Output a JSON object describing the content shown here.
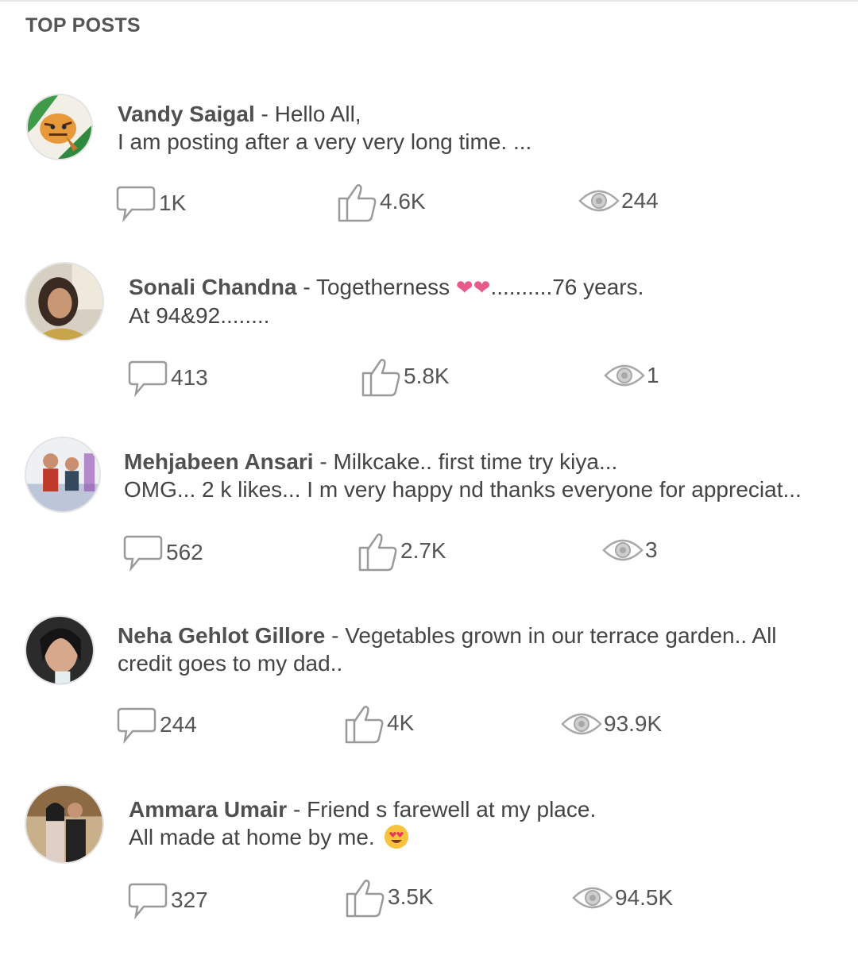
{
  "header": {
    "title": "TOP POSTS"
  },
  "separator": " - ",
  "posts": [
    {
      "author": "Vandy Saigal",
      "line1": "Hello All,",
      "line2": "I am posting after a very very long time. ...",
      "comments": "1K",
      "likes": "4.6K",
      "views": "244",
      "avatar": "tiger-painting"
    },
    {
      "author": "Sonali Chandna",
      "line1": "Togetherness ",
      "line1_emoji": "❤❤",
      "line1_after": "..........76 years.",
      "line2": "At 94&92........",
      "comments": "413",
      "likes": "5.8K",
      "views": "1",
      "avatar": "woman-portrait"
    },
    {
      "author": "Mehjabeen Ansari",
      "line1": "Milkcake.. first time try kiya...",
      "line2": "OMG... 2 k likes... I m very happy nd thanks everyone for appreciat...",
      "comments": "562",
      "likes": "2.7K",
      "views": "3",
      "avatar": "children-photo"
    },
    {
      "author": "Neha Gehlot Gillore",
      "line1": "Vegetables grown in our terrace garden.. All",
      "line2": "credit goes to my dad..",
      "comments": "244",
      "likes": "4K",
      "views": "93.9K",
      "avatar": "woman-selfie"
    },
    {
      "author": "Ammara Umair",
      "line1": "Friend s farewell at my place.",
      "line2": "All made at home by me. ",
      "line2_emoji": "smiling-face-with-heart-eyes",
      "comments": "327",
      "likes": "3.5K",
      "views": "94.5K",
      "avatar": "couple-photo"
    }
  ]
}
